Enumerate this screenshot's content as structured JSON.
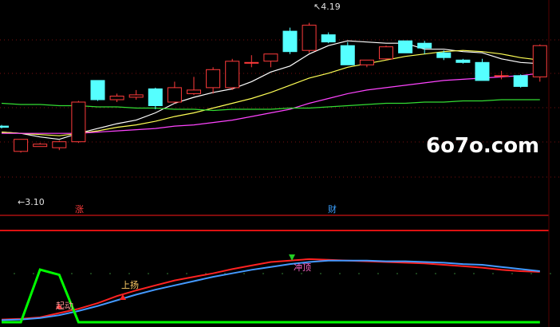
{
  "chart_data": [
    {
      "type": "candlestick",
      "panel": "main",
      "bull_color": "#ff3b3b",
      "bear_color": "#55ffff",
      "ylim": [
        2.72,
        4.3
      ],
      "annotations": {
        "high_label": "4.19",
        "low_label": "3.10",
        "signal_a": "涨",
        "signal_b": "财",
        "signal_a_color": "#ff3b3b",
        "signal_b_color": "#3aa0ff"
      },
      "watermark": "6o7o.com",
      "candles": [
        {
          "o": 3.33,
          "h": 3.34,
          "l": 3.31,
          "c": 3.32
        },
        {
          "o": 3.12,
          "h": 3.22,
          "l": 3.11,
          "c": 3.22
        },
        {
          "o": 3.16,
          "h": 3.19,
          "l": 3.16,
          "c": 3.18
        },
        {
          "o": 3.15,
          "h": 3.21,
          "l": 3.13,
          "c": 3.2
        },
        {
          "o": 3.2,
          "h": 3.54,
          "l": 3.19,
          "c": 3.53
        },
        {
          "o": 3.71,
          "h": 3.71,
          "l": 3.54,
          "c": 3.55
        },
        {
          "o": 3.55,
          "h": 3.6,
          "l": 3.53,
          "c": 3.58
        },
        {
          "o": 3.57,
          "h": 3.63,
          "l": 3.55,
          "c": 3.59
        },
        {
          "o": 3.64,
          "h": 3.65,
          "l": 3.47,
          "c": 3.5
        },
        {
          "o": 3.53,
          "h": 3.7,
          "l": 3.52,
          "c": 3.65
        },
        {
          "o": 3.6,
          "h": 3.74,
          "l": 3.59,
          "c": 3.63
        },
        {
          "o": 3.65,
          "h": 3.82,
          "l": 3.6,
          "c": 3.8
        },
        {
          "o": 3.65,
          "h": 3.89,
          "l": 3.63,
          "c": 3.87
        },
        {
          "o": 3.86,
          "h": 3.92,
          "l": 3.82,
          "c": 3.86
        },
        {
          "o": 3.87,
          "h": 3.91,
          "l": 3.82,
          "c": 3.93
        },
        {
          "o": 4.12,
          "h": 4.15,
          "l": 3.93,
          "c": 3.95
        },
        {
          "o": 3.96,
          "h": 4.19,
          "l": 3.94,
          "c": 4.17
        },
        {
          "o": 4.09,
          "h": 4.11,
          "l": 4.02,
          "c": 4.03
        },
        {
          "o": 4.0,
          "h": 4.03,
          "l": 3.84,
          "c": 3.84
        },
        {
          "o": 3.84,
          "h": 3.88,
          "l": 3.82,
          "c": 3.88
        },
        {
          "o": 3.89,
          "h": 4.0,
          "l": 3.88,
          "c": 3.99
        },
        {
          "o": 4.04,
          "h": 4.04,
          "l": 3.94,
          "c": 3.94
        },
        {
          "o": 4.02,
          "h": 4.04,
          "l": 3.93,
          "c": 3.98
        },
        {
          "o": 3.94,
          "h": 3.96,
          "l": 3.88,
          "c": 3.9
        },
        {
          "o": 3.88,
          "h": 3.89,
          "l": 3.85,
          "c": 3.86
        },
        {
          "o": 3.86,
          "h": 3.89,
          "l": 3.71,
          "c": 3.71
        },
        {
          "o": 3.75,
          "h": 3.79,
          "l": 3.72,
          "c": 3.75
        },
        {
          "o": 3.75,
          "h": 3.76,
          "l": 3.65,
          "c": 3.66
        },
        {
          "o": 3.74,
          "h": 4.01,
          "l": 3.7,
          "c": 4.0
        }
      ],
      "series": [
        {
          "color": "#ffffff",
          "values": [
            3.28,
            3.27,
            3.24,
            3.22,
            3.27,
            3.31,
            3.35,
            3.38,
            3.44,
            3.52,
            3.57,
            3.61,
            3.64,
            3.7,
            3.78,
            3.83,
            3.93,
            4.0,
            4.04,
            4.03,
            4.02,
            4.02,
            3.97,
            3.97,
            3.95,
            3.94,
            3.89,
            3.86,
            3.85
          ]
        },
        {
          "color": "#ffff55",
          "values": [
            3.28,
            3.27,
            3.26,
            3.25,
            3.27,
            3.29,
            3.32,
            3.34,
            3.37,
            3.41,
            3.44,
            3.48,
            3.52,
            3.56,
            3.61,
            3.67,
            3.73,
            3.77,
            3.82,
            3.85,
            3.88,
            3.91,
            3.93,
            3.95,
            3.96,
            3.95,
            3.93,
            3.9,
            3.88
          ]
        },
        {
          "color": "#ff44ff",
          "values": [
            3.27,
            3.27,
            3.27,
            3.27,
            3.27,
            3.28,
            3.29,
            3.3,
            3.31,
            3.33,
            3.34,
            3.36,
            3.38,
            3.41,
            3.44,
            3.47,
            3.52,
            3.56,
            3.6,
            3.63,
            3.65,
            3.67,
            3.69,
            3.71,
            3.72,
            3.73,
            3.74,
            3.75,
            3.77
          ]
        },
        {
          "color": "#33dd33",
          "values": [
            3.52,
            3.51,
            3.51,
            3.5,
            3.5,
            3.49,
            3.49,
            3.48,
            3.48,
            3.47,
            3.47,
            3.46,
            3.47,
            3.47,
            3.47,
            3.48,
            3.48,
            3.49,
            3.5,
            3.51,
            3.52,
            3.52,
            3.53,
            3.53,
            3.54,
            3.54,
            3.55,
            3.55,
            3.55
          ]
        }
      ]
    },
    {
      "type": "line",
      "panel": "indicator",
      "ylim": [
        0,
        100
      ],
      "series": [
        {
          "color": "#ff2222",
          "values": [
            5,
            6,
            8,
            14,
            20,
            28,
            38,
            46,
            53,
            60,
            65,
            70,
            76,
            81,
            86,
            88,
            90,
            89,
            88,
            87,
            86,
            85,
            84,
            82,
            80,
            78,
            75,
            73,
            72
          ]
        },
        {
          "color": "#4499ff",
          "values": [
            4,
            5,
            7,
            11,
            17,
            24,
            32,
            40,
            47,
            53,
            59,
            65,
            70,
            75,
            79,
            83,
            86,
            88,
            88,
            88,
            87,
            87,
            86,
            85,
            83,
            82,
            79,
            76,
            73
          ]
        },
        {
          "color": "#00ff00",
          "values": [
            0,
            0,
            1,
            0.9,
            0,
            0,
            0,
            0,
            0,
            0,
            0,
            0,
            0,
            0,
            0,
            0,
            0,
            0,
            0,
            0,
            0,
            0,
            0,
            0,
            0,
            0,
            0,
            0,
            0
          ]
        }
      ],
      "annotations": {
        "start_label": "起动",
        "rise_label": "上扬",
        "top_label": "冲顶"
      }
    }
  ]
}
